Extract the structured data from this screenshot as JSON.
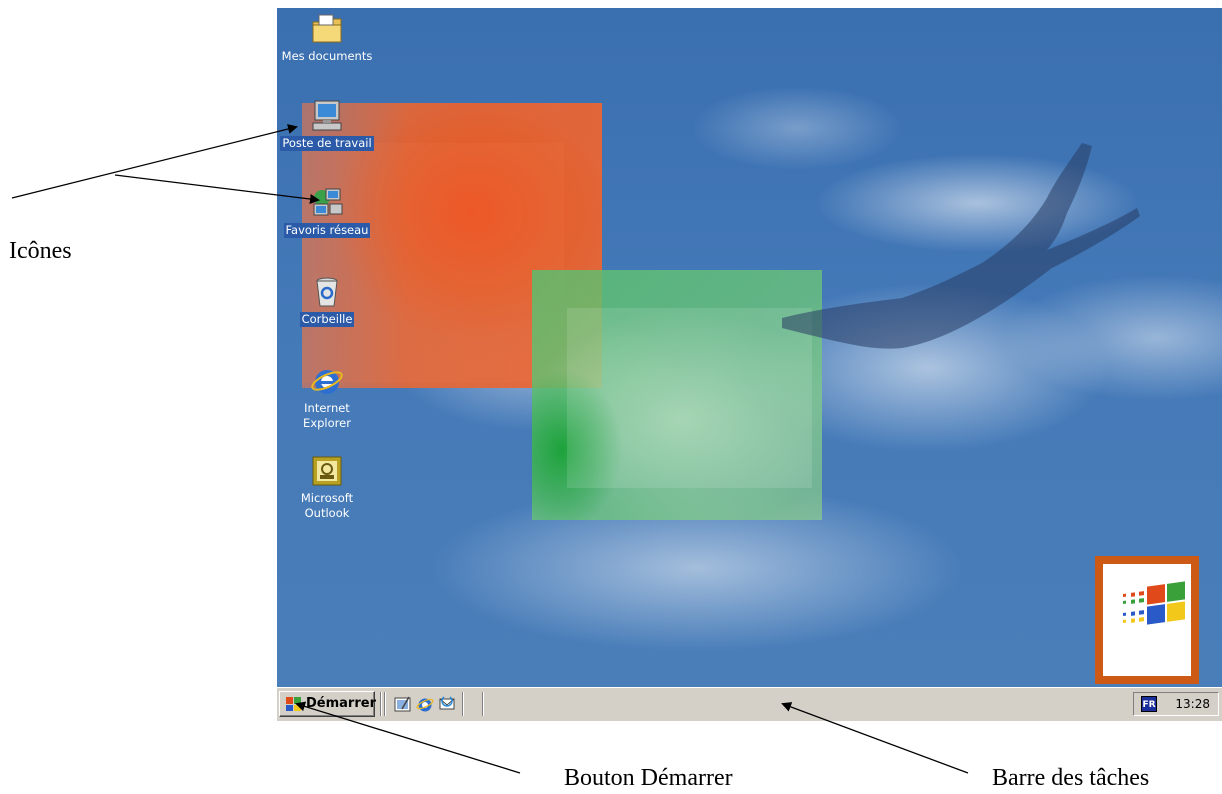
{
  "desktop": {
    "icons": [
      {
        "label": "Mes documents",
        "icon": "folder-icon"
      },
      {
        "label": "Poste de travail",
        "icon": "computer-icon"
      },
      {
        "label": "Favoris réseau",
        "icon": "network-icon"
      },
      {
        "label": "Corbeille",
        "icon": "recycle-bin-icon"
      },
      {
        "label": "Internet Explorer",
        "icon": "internet-explorer-icon"
      },
      {
        "label": "Microsoft Outlook",
        "icon": "outlook-icon"
      }
    ],
    "logo": "windows-logo"
  },
  "taskbar": {
    "start_label": "Démarrer",
    "quick_launch": [
      "show-desktop-icon",
      "internet-explorer-icon",
      "outlook-express-icon"
    ],
    "language": "FR",
    "clock": "13:28"
  },
  "annotations": {
    "icons": "Icônes",
    "start_button": "Bouton Démarrer",
    "taskbar": "Barre des tâches"
  },
  "colors": {
    "desktop_blue": "#4479b8",
    "taskbar_gray": "#d4d0c8",
    "selection_blue": "#2a5aa8",
    "logo_orange": "#cc5a14"
  }
}
